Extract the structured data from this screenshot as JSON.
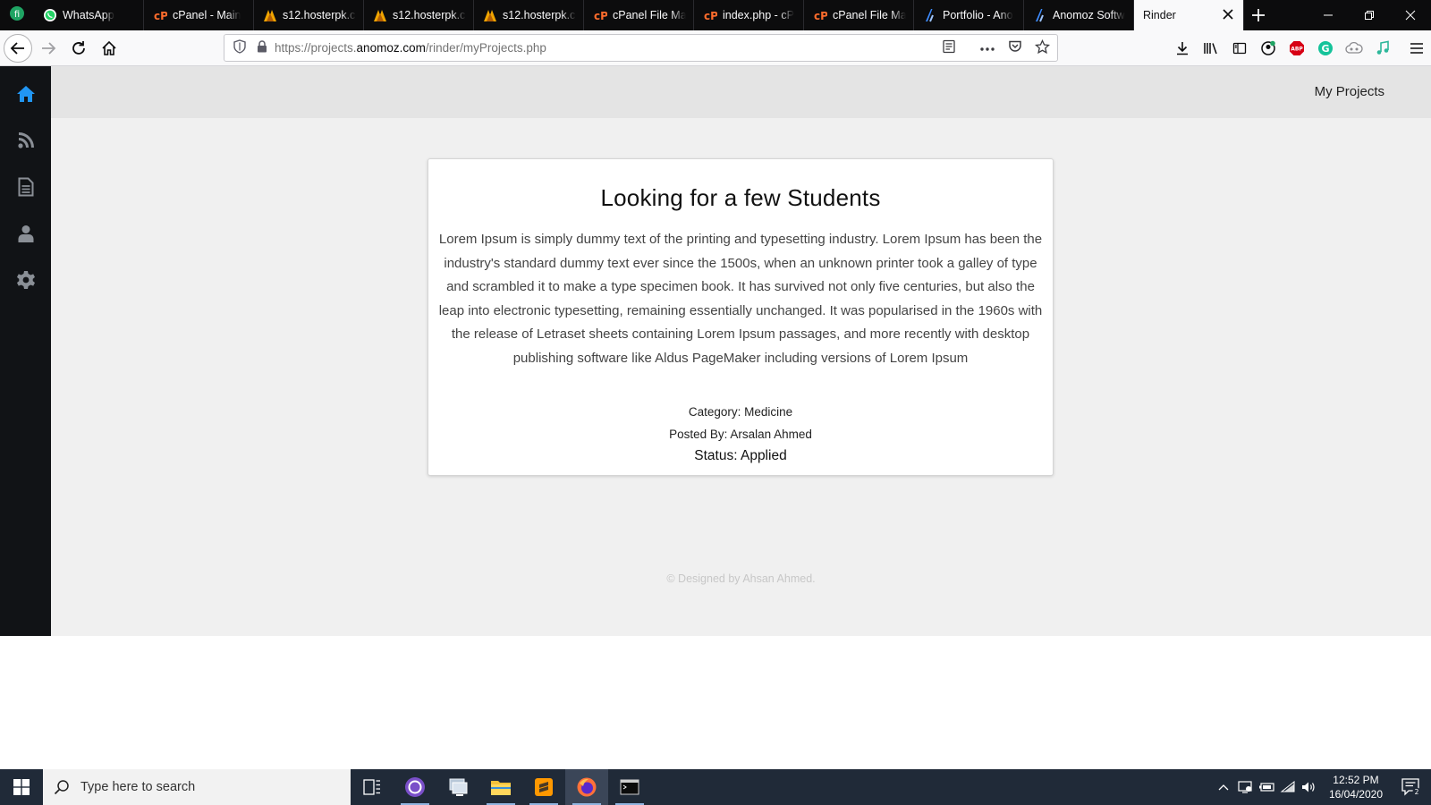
{
  "browser": {
    "tabs": [
      {
        "label": "WhatsApp",
        "icon": "whatsapp-icon"
      },
      {
        "label": "cPanel - Main",
        "icon": "cpanel-icon"
      },
      {
        "label": "s12.hosterpk.co",
        "icon": "hosterpk-icon"
      },
      {
        "label": "s12.hosterpk.co",
        "icon": "hosterpk-icon"
      },
      {
        "label": "s12.hosterpk.co",
        "icon": "hosterpk-icon"
      },
      {
        "label": "cPanel File Man",
        "icon": "cpanel-icon"
      },
      {
        "label": "index.php - cP",
        "icon": "cpanel-icon"
      },
      {
        "label": "cPanel File Man",
        "icon": "cpanel-icon"
      },
      {
        "label": "Portfolio - Ano",
        "icon": "anomoz-icon"
      },
      {
        "label": "Anomoz Softw",
        "icon": "anomoz-icon"
      },
      {
        "label": "Rinder",
        "icon": "none",
        "active": true
      }
    ],
    "url_prefix": "https://projects.",
    "url_domain": "anomoz.com",
    "url_path": "/rinder/myProjects.php"
  },
  "header": {
    "nav_label": "My Projects"
  },
  "sidebar": {
    "items": [
      {
        "icon": "home-icon",
        "color": "#2196f3"
      },
      {
        "icon": "rss-feed-icon",
        "color": "#8a8f96"
      },
      {
        "icon": "document-icon",
        "color": "#8a8f96"
      },
      {
        "icon": "user-icon",
        "color": "#8a8f96"
      },
      {
        "icon": "gear-icon",
        "color": "#8a8f96"
      }
    ]
  },
  "project": {
    "title": "Looking for a few Students",
    "description": "Lorem Ipsum is simply dummy text of the printing and typesetting industry. Lorem Ipsum has been the industry's standard dummy text ever since the 1500s, when an unknown printer took a galley of type and scrambled it to make a type specimen book. It has survived not only five centuries, but also the leap into electronic typesetting, remaining essentially unchanged. It was popularised in the 1960s with the release of Letraset sheets containing Lorem Ipsum passages, and more recently with desktop publishing software like Aldus PageMaker including versions of Lorem Ipsum",
    "category": "Category: Medicine",
    "posted_by": "Posted By: Arsalan Ahmed",
    "status": "Status: Applied"
  },
  "footer": {
    "text": "© Designed by Ahsan Ahmed."
  },
  "taskbar": {
    "search_placeholder": "Type here to search",
    "time": "12:52 PM",
    "date": "16/04/2020",
    "notification_count": "2"
  }
}
